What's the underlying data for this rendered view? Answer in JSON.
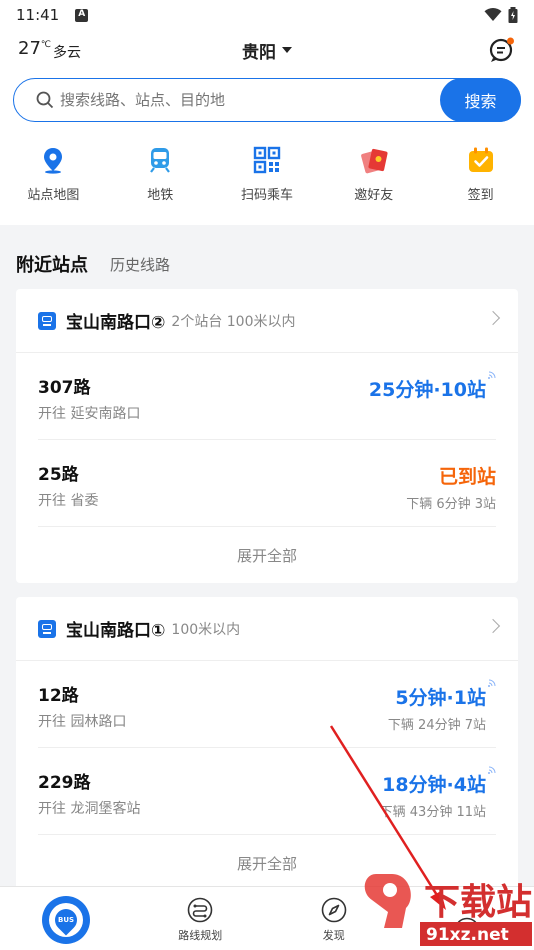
{
  "status": {
    "time": "11:41"
  },
  "header": {
    "temperature": "27",
    "unit": "℃",
    "condition": "多云",
    "city": "贵阳"
  },
  "search": {
    "placeholder": "搜索线路、站点、目的地",
    "button": "搜索"
  },
  "quick": [
    {
      "label": "站点地图",
      "icon": "map-pin-icon"
    },
    {
      "label": "地铁",
      "icon": "subway-icon"
    },
    {
      "label": "扫码乘车",
      "icon": "qr-code-icon"
    },
    {
      "label": "邀好友",
      "icon": "red-envelope-icon"
    },
    {
      "label": "签到",
      "icon": "check-in-icon"
    }
  ],
  "tabs": {
    "nearby": "附近站点",
    "history": "历史线路"
  },
  "stops": [
    {
      "name": "宝山南路口②",
      "meta": "2个站台 100米以内",
      "routes": [
        {
          "name": "307路",
          "direction": "开往 延安南路口",
          "eta": "25分钟·10站",
          "next": ""
        },
        {
          "name": "25路",
          "direction": "开往 省委",
          "eta": "已到站",
          "next": "下辆  6分钟 3站"
        }
      ],
      "expand": "展开全部"
    },
    {
      "name": "宝山南路口①",
      "meta": "100米以内",
      "routes": [
        {
          "name": "12路",
          "direction": "开往 园林路口",
          "eta": "5分钟·1站",
          "next": "下辆  24分钟 7站"
        },
        {
          "name": "229路",
          "direction": "开往 龙洞堡客站",
          "eta": "18分钟·4站",
          "next": "下辆  43分钟 11站"
        }
      ],
      "expand": "展开全部"
    }
  ],
  "bottom_nav": {
    "home_badge": "BUS",
    "route_plan": "路线规划",
    "discover": "发现"
  },
  "watermark": {
    "text": "下载站",
    "url": "91xz.net"
  },
  "colors": {
    "primary": "#1a73e8",
    "arrived": "#f5650a"
  }
}
